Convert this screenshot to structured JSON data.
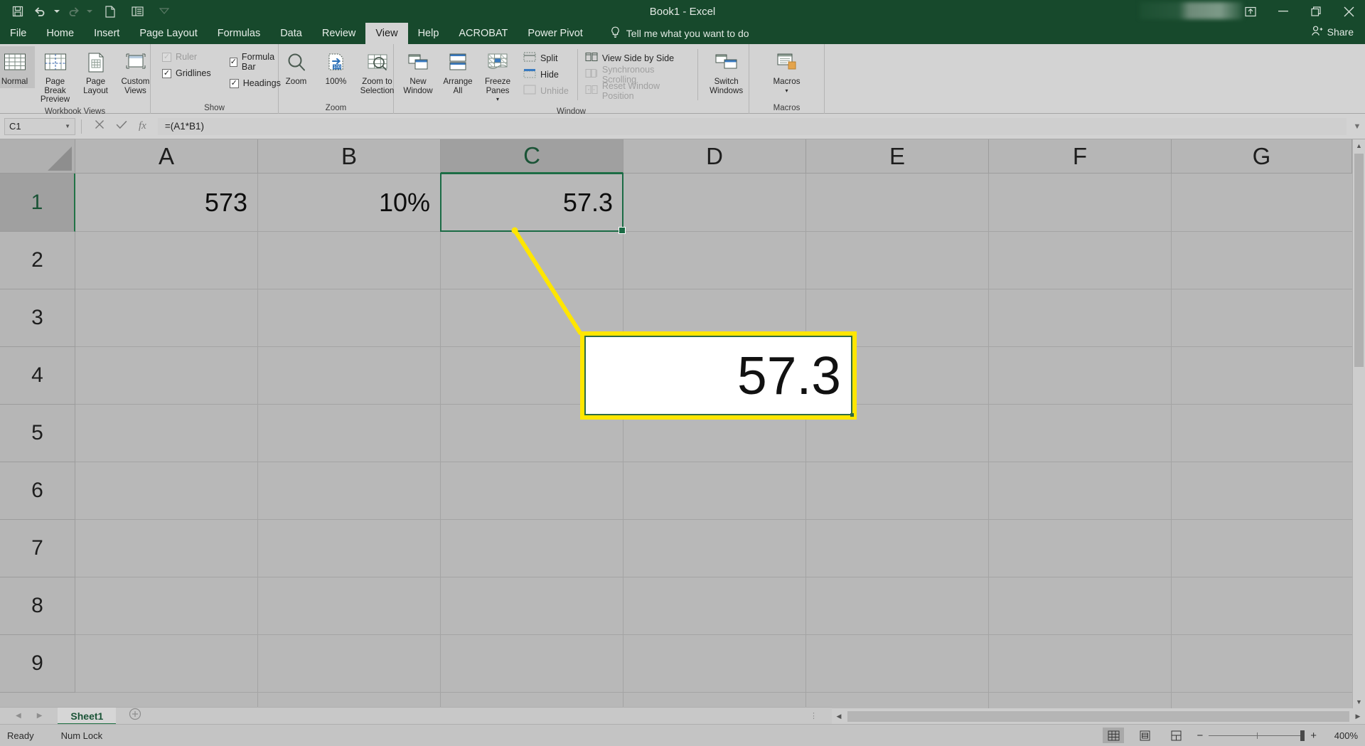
{
  "window": {
    "title": "Book1 - Excel",
    "quick_access": [
      {
        "name": "save",
        "label": "Save"
      },
      {
        "name": "undo",
        "label": "Undo"
      },
      {
        "name": "redo",
        "label": "Redo"
      },
      {
        "name": "new",
        "label": "New"
      },
      {
        "name": "touch-mode",
        "label": "Touch/Mouse Mode"
      },
      {
        "name": "customize",
        "label": "Customize Quick Access Toolbar"
      }
    ],
    "controls": {
      "ribbon_display": "Ribbon Display Options",
      "minimize": "Minimize",
      "restore": "Restore Down",
      "close": "Close"
    },
    "share_label": "Share"
  },
  "tabs": [
    {
      "label": "File",
      "active": false
    },
    {
      "label": "Home",
      "active": false
    },
    {
      "label": "Insert",
      "active": false
    },
    {
      "label": "Page Layout",
      "active": false
    },
    {
      "label": "Formulas",
      "active": false
    },
    {
      "label": "Data",
      "active": false
    },
    {
      "label": "Review",
      "active": false
    },
    {
      "label": "View",
      "active": true
    },
    {
      "label": "Help",
      "active": false
    },
    {
      "label": "ACROBAT",
      "active": false
    },
    {
      "label": "Power Pivot",
      "active": false
    }
  ],
  "tell_me": "Tell me what you want to do",
  "ribbon": {
    "groups": [
      {
        "title": "Workbook Views",
        "buttons": [
          {
            "label": "Normal",
            "selected": true
          },
          {
            "label": "Page Break Preview",
            "selected": false
          },
          {
            "label": "Page Layout",
            "selected": false
          },
          {
            "label": "Custom Views",
            "selected": false
          }
        ]
      },
      {
        "title": "Show",
        "checks": [
          {
            "label": "Ruler",
            "checked": true,
            "disabled": true
          },
          {
            "label": "Formula Bar",
            "checked": true,
            "disabled": false
          },
          {
            "label": "Gridlines",
            "checked": true,
            "disabled": false
          },
          {
            "label": "Headings",
            "checked": true,
            "disabled": false
          }
        ]
      },
      {
        "title": "Zoom",
        "buttons": [
          {
            "label": "Zoom",
            "selected": false
          },
          {
            "label": "100%",
            "selected": false
          },
          {
            "label": "Zoom to Selection",
            "selected": false
          }
        ]
      },
      {
        "title": "Window",
        "buttons": [
          {
            "label": "New Window",
            "selected": false
          },
          {
            "label": "Arrange All",
            "selected": false
          },
          {
            "label": "Freeze Panes",
            "selected": false
          }
        ],
        "small_left": [
          {
            "label": "Split",
            "disabled": false
          },
          {
            "label": "Hide",
            "disabled": false
          },
          {
            "label": "Unhide",
            "disabled": true
          }
        ],
        "small_right": [
          {
            "label": "View Side by Side",
            "disabled": false
          },
          {
            "label": "Synchronous Scrolling",
            "disabled": true
          },
          {
            "label": "Reset Window Position",
            "disabled": true
          }
        ],
        "switch_windows": "Switch Windows"
      },
      {
        "title": "Macros",
        "buttons": [
          {
            "label": "Macros",
            "selected": false
          }
        ]
      }
    ]
  },
  "formula_bar": {
    "name_box_value": "C1",
    "cancel_label": "Cancel",
    "enter_label": "Enter",
    "fx_label": "Insert Function",
    "formula": "=(A1*B1)",
    "expand_label": "Expand Formula Bar"
  },
  "grid": {
    "columns": [
      "A",
      "B",
      "C",
      "D",
      "E",
      "F",
      "G"
    ],
    "rows": [
      "1",
      "2",
      "3",
      "4",
      "5",
      "6",
      "7",
      "8",
      "9"
    ],
    "selected_column": "C",
    "selected_row": "1",
    "cells": [
      {
        "ref": "A1",
        "value": "573"
      },
      {
        "ref": "B1",
        "value": "10%"
      },
      {
        "ref": "C1",
        "value": "57.3"
      }
    ]
  },
  "callout": {
    "value": "57.3",
    "highlight_color": "#ffe600",
    "border_color": "#2e6b45"
  },
  "sheet_tabs": {
    "tabs": [
      {
        "label": "Sheet1",
        "active": true
      }
    ],
    "add_label": "New sheet",
    "prev_label": "Previous sheet",
    "next_label": "Next sheet"
  },
  "status_bar": {
    "ready": "Ready",
    "num_lock": "Num Lock",
    "views": [
      {
        "name": "normal-view",
        "label": "Normal",
        "active": true
      },
      {
        "name": "page-layout-view",
        "label": "Page Layout",
        "active": false
      },
      {
        "name": "page-break-view",
        "label": "Page Break Preview",
        "active": false
      }
    ],
    "zoom_out": "Zoom Out",
    "zoom_in": "Zoom In",
    "zoom_level": "400%"
  }
}
